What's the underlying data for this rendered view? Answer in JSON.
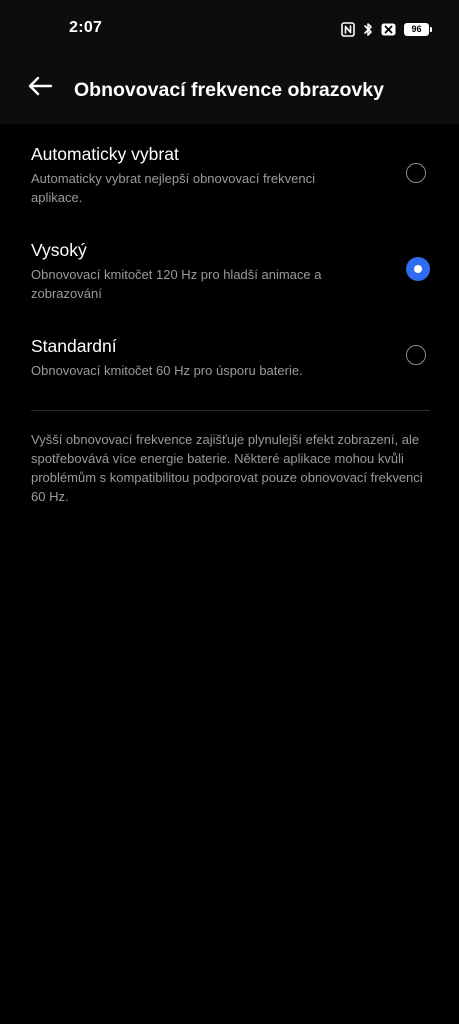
{
  "status_bar": {
    "time": "2:07",
    "battery_level": "96",
    "icons": [
      "nfc-icon",
      "bluetooth-icon",
      "x-icon",
      "battery-icon"
    ]
  },
  "header": {
    "back_icon": "back-arrow-icon",
    "title": "Obnovovací frekvence obrazovky"
  },
  "options": [
    {
      "title": "Automaticky vybrat",
      "description": "Automaticky vybrat nejlepší obnovovací frekvenci aplikace.",
      "selected": false
    },
    {
      "title": "Vysoký",
      "description": "Obnovovací kmitočet 120 Hz pro hladší animace a zobrazování",
      "selected": true
    },
    {
      "title": "Standardní",
      "description": "Obnovovací kmitočet 60 Hz pro úsporu baterie.",
      "selected": false
    }
  ],
  "footer_note": "Vyšší obnovovací frekvence zajišťuje plynulejší efekt zobrazení, ale spotřebovává více energie baterie. Některé aplikace mohou kvůli problémům s kompatibilitou podporovat pouze obnovovací frekvenci 60 Hz.",
  "colors": {
    "accent": "#2f6cf0",
    "background": "#000000",
    "header_background": "#0d0d0d",
    "secondary_text": "#9a9a9a"
  }
}
